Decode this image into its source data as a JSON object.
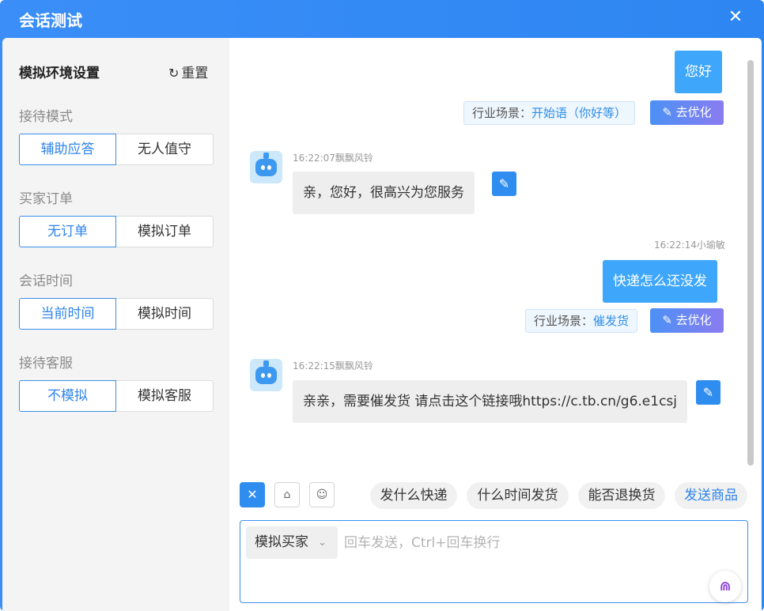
{
  "window": {
    "title": "会话测试"
  },
  "sidebar": {
    "heading": "模拟环境设置",
    "reset_label": "重置",
    "groups": [
      {
        "label": "接待模式",
        "options": [
          "辅助应答",
          "无人值守"
        ],
        "selected": 0
      },
      {
        "label": "买家订单",
        "options": [
          "无订单",
          "模拟订单"
        ],
        "selected": 0
      },
      {
        "label": "会话时间",
        "options": [
          "当前时间",
          "模拟时间"
        ],
        "selected": 0
      },
      {
        "label": "接待客服",
        "options": [
          "不模拟",
          "模拟客服"
        ],
        "selected": 0
      }
    ]
  },
  "chat": {
    "messages": [
      {
        "from": "buyer",
        "text": "您好",
        "scene_label": "行业场景：",
        "scene_value": "开始语（你好等）",
        "optimize": "去优化"
      },
      {
        "from": "bot",
        "meta": "16:22:07飘飘风铃",
        "text": "亲，您好，很高兴为您服务"
      },
      {
        "from": "buyer",
        "meta": "16:22:14小瑜敏",
        "text": "快递怎么还没发",
        "scene_label": "行业场景：",
        "scene_value": "催发货",
        "optimize": "去优化"
      },
      {
        "from": "bot",
        "meta": "16:22:15飘飘风铃",
        "text": "亲亲，需要催发货 请点击这个链接哦https://c.tb.cn/g6.e1csj"
      }
    ]
  },
  "toolbar": {
    "tools": [
      "close-icon",
      "tag-icon",
      "bot-icon"
    ],
    "quick_replies": [
      "发什么快递",
      "什么时间发货",
      "能否退换货"
    ],
    "send_product": "发送商品"
  },
  "composer": {
    "role": "模拟买家",
    "placeholder": "回车发送，Ctrl+回车换行"
  },
  "colors": {
    "accent": "#2f8df0",
    "buyer_bubble": "#3fa7fb",
    "bot_bubble": "#eeeeee"
  }
}
